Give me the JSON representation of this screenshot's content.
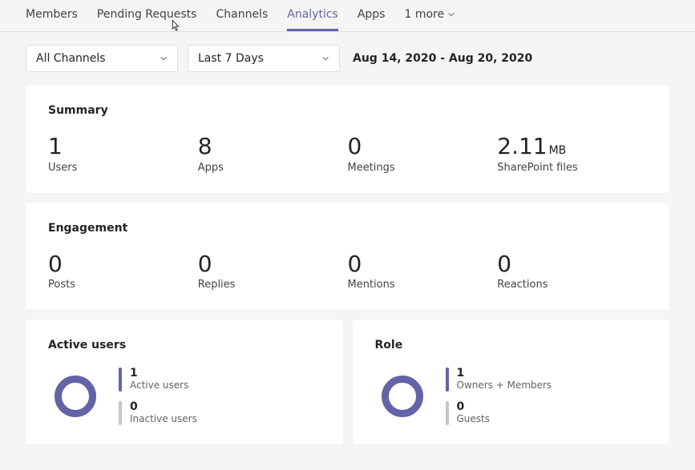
{
  "tabs": {
    "members": "Members",
    "pending": "Pending Requests",
    "channels": "Channels",
    "analytics": "Analytics",
    "apps": "Apps",
    "more": "1 more"
  },
  "filters": {
    "channels": "All Channels",
    "range": "Last 7 Days",
    "date_range": "Aug 14, 2020 - Aug 20, 2020"
  },
  "summary": {
    "title": "Summary",
    "users": {
      "value": "1",
      "label": "Users"
    },
    "apps": {
      "value": "8",
      "label": "Apps"
    },
    "meetings": {
      "value": "0",
      "label": "Meetings"
    },
    "sharepoint": {
      "value": "2.11",
      "unit": "MB",
      "label": "SharePoint files"
    }
  },
  "engagement": {
    "title": "Engagement",
    "posts": {
      "value": "0",
      "label": "Posts"
    },
    "replies": {
      "value": "0",
      "label": "Replies"
    },
    "mentions": {
      "value": "0",
      "label": "Mentions"
    },
    "reactions": {
      "value": "0",
      "label": "Reactions"
    }
  },
  "active_users": {
    "title": "Active users",
    "active": {
      "value": "1",
      "label": "Active users"
    },
    "inactive": {
      "value": "0",
      "label": "Inactive users"
    }
  },
  "role": {
    "title": "Role",
    "owners": {
      "value": "1",
      "label": "Owners + Members"
    },
    "guests": {
      "value": "0",
      "label": "Guests"
    }
  },
  "chart_data": [
    {
      "type": "pie",
      "title": "Active users",
      "series": [
        {
          "name": "Active users",
          "value": 1,
          "color": "#6264a7"
        },
        {
          "name": "Inactive users",
          "value": 0,
          "color": "#c8c6c4"
        }
      ]
    },
    {
      "type": "pie",
      "title": "Role",
      "series": [
        {
          "name": "Owners + Members",
          "value": 1,
          "color": "#6264a7"
        },
        {
          "name": "Guests",
          "value": 0,
          "color": "#c8c6c4"
        }
      ]
    }
  ]
}
